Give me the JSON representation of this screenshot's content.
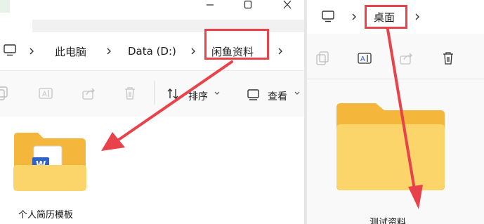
{
  "left_window": {
    "breadcrumb": [
      "此电脑",
      "Data (D:)",
      "闲鱼资料"
    ],
    "toolbar": {
      "sort_label": "排序",
      "view_label": "查看"
    },
    "file": {
      "name": "个人简历模板",
      "badge": "W"
    }
  },
  "right_window": {
    "breadcrumb": [
      "桌面"
    ],
    "file": {
      "name": "测试资料"
    }
  },
  "annotation_color": "#e8424a",
  "folder_colors": {
    "back": "#f4b73b",
    "front": "#fbd56a"
  }
}
